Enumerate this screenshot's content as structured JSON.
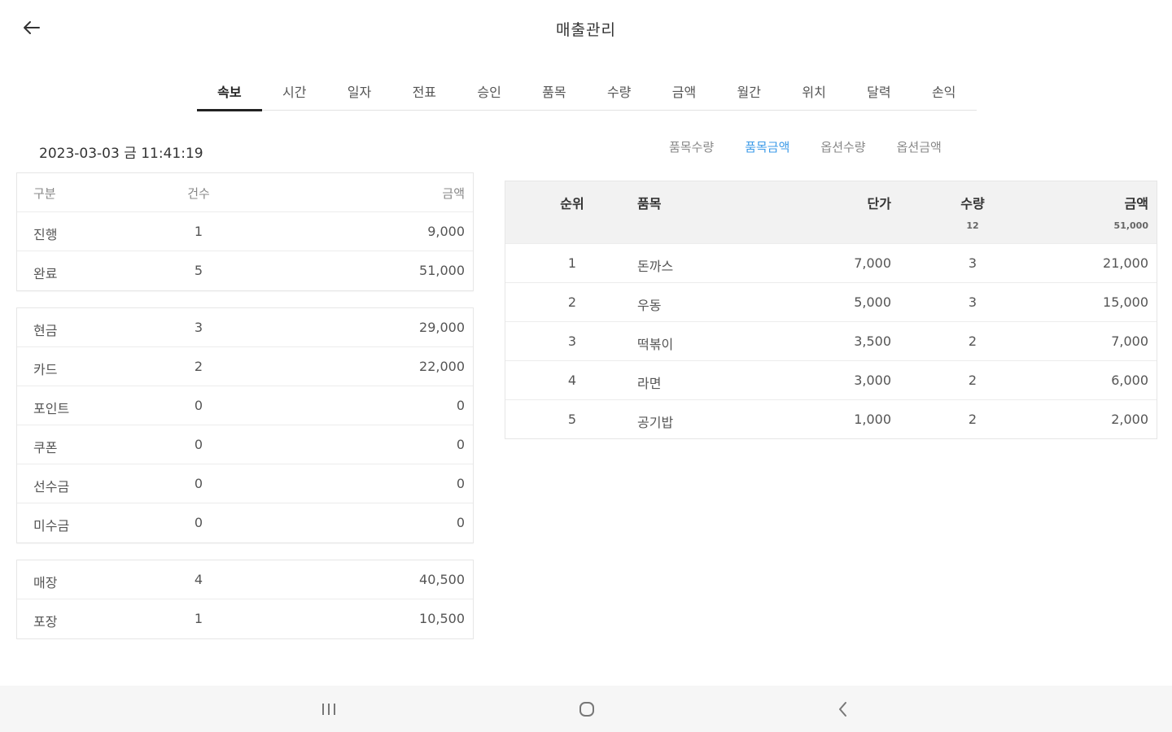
{
  "header": {
    "title": "매출관리"
  },
  "tabs": [
    "속보",
    "시간",
    "일자",
    "전표",
    "승인",
    "품목",
    "수량",
    "금액",
    "월간",
    "위치",
    "달력",
    "손익"
  ],
  "active_tab": 0,
  "datetime": "2023-03-03 금 11:41:19",
  "subtabs": [
    "품목수량",
    "품목금액",
    "옵션수량",
    "옵션금액"
  ],
  "active_subtab": 1,
  "left": {
    "header": {
      "c1": "구분",
      "c2": "건수",
      "c3": "금액"
    },
    "status": [
      {
        "label": "진행",
        "count": "1",
        "amount": "9,000"
      },
      {
        "label": "완료",
        "count": "5",
        "amount": "51,000"
      }
    ],
    "payment": [
      {
        "label": "현금",
        "count": "3",
        "amount": "29,000"
      },
      {
        "label": "카드",
        "count": "2",
        "amount": "22,000"
      },
      {
        "label": "포인트",
        "count": "0",
        "amount": "0"
      },
      {
        "label": "쿠폰",
        "count": "0",
        "amount": "0"
      },
      {
        "label": "선수금",
        "count": "0",
        "amount": "0"
      },
      {
        "label": "미수금",
        "count": "0",
        "amount": "0"
      }
    ],
    "channel": [
      {
        "label": "매장",
        "count": "4",
        "amount": "40,500"
      },
      {
        "label": "포장",
        "count": "1",
        "amount": "10,500"
      }
    ]
  },
  "right": {
    "header": {
      "rank": "순위",
      "item": "품목",
      "price": "단가",
      "qty": "수량",
      "qty_total": "12",
      "amount": "금액",
      "amount_total": "51,000"
    },
    "rows": [
      {
        "rank": "1",
        "item": "돈까스",
        "price": "7,000",
        "qty": "3",
        "amount": "21,000"
      },
      {
        "rank": "2",
        "item": "우동",
        "price": "5,000",
        "qty": "3",
        "amount": "15,000"
      },
      {
        "rank": "3",
        "item": "떡볶이",
        "price": "3,500",
        "qty": "2",
        "amount": "7,000"
      },
      {
        "rank": "4",
        "item": "라면",
        "price": "3,000",
        "qty": "2",
        "amount": "6,000"
      },
      {
        "rank": "5",
        "item": "공기밥",
        "price": "1,000",
        "qty": "2",
        "amount": "2,000"
      }
    ]
  },
  "icons": {
    "back": "arrow-left-icon",
    "recent": "recent-apps-icon",
    "home": "home-icon",
    "navback": "chevron-left-icon"
  },
  "colors": {
    "accent": "#3d9be8"
  }
}
